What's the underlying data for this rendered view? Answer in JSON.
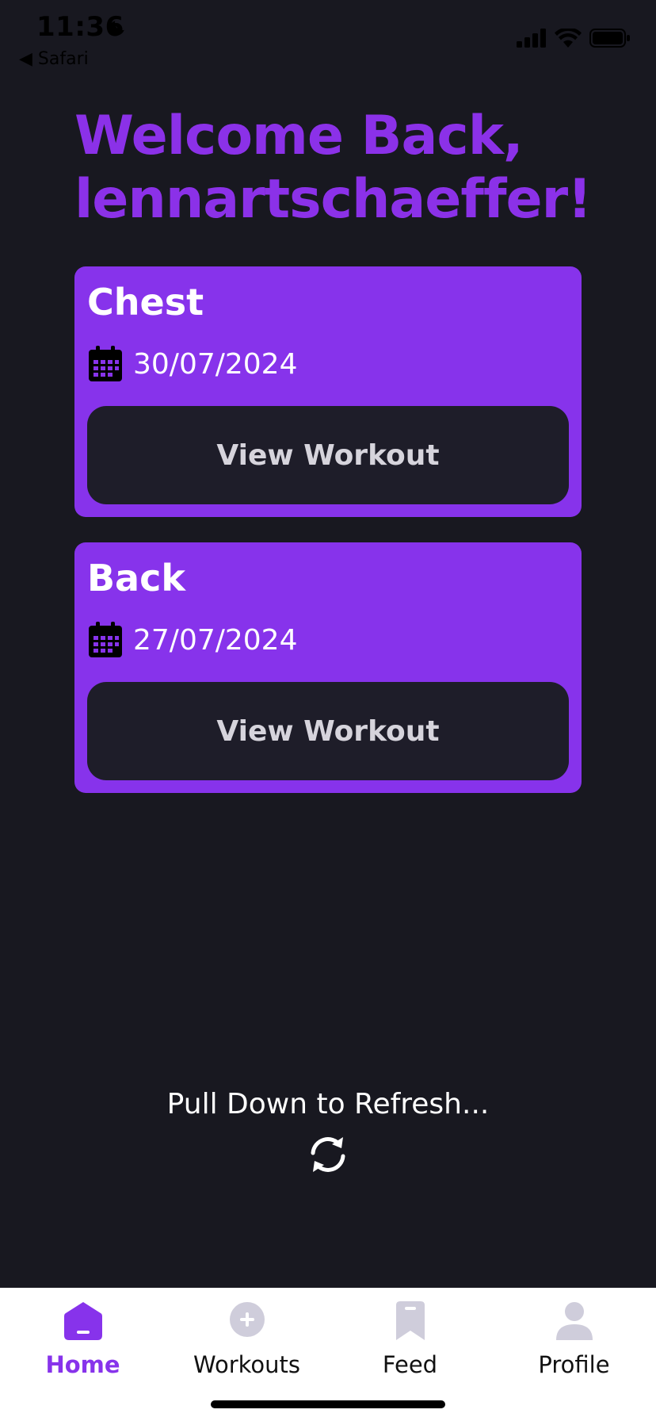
{
  "status_bar": {
    "time": "11:36",
    "back_app": "◀ Safari"
  },
  "header": {
    "title_line1": "Welcome Back,",
    "title_line2": "lennartschaeffer!"
  },
  "workouts": [
    {
      "name": "Chest",
      "date": "30/07/2024",
      "button_label": "View Workout"
    },
    {
      "name": "Back",
      "date": "27/07/2024",
      "button_label": "View Workout"
    }
  ],
  "refresh": {
    "label": "Pull Down to Refresh..."
  },
  "tabbar": {
    "tabs": [
      {
        "label": "Home",
        "icon": "home-icon",
        "active": true
      },
      {
        "label": "Workouts",
        "icon": "plus-circle-icon",
        "active": false
      },
      {
        "label": "Feed",
        "icon": "bookmark-icon",
        "active": false
      },
      {
        "label": "Profile",
        "icon": "person-icon",
        "active": false
      }
    ]
  },
  "colors": {
    "accent": "#8733EB",
    "background": "#181820",
    "button": "#1E1D29",
    "tab_inactive_icon": "#CFCDDB"
  }
}
